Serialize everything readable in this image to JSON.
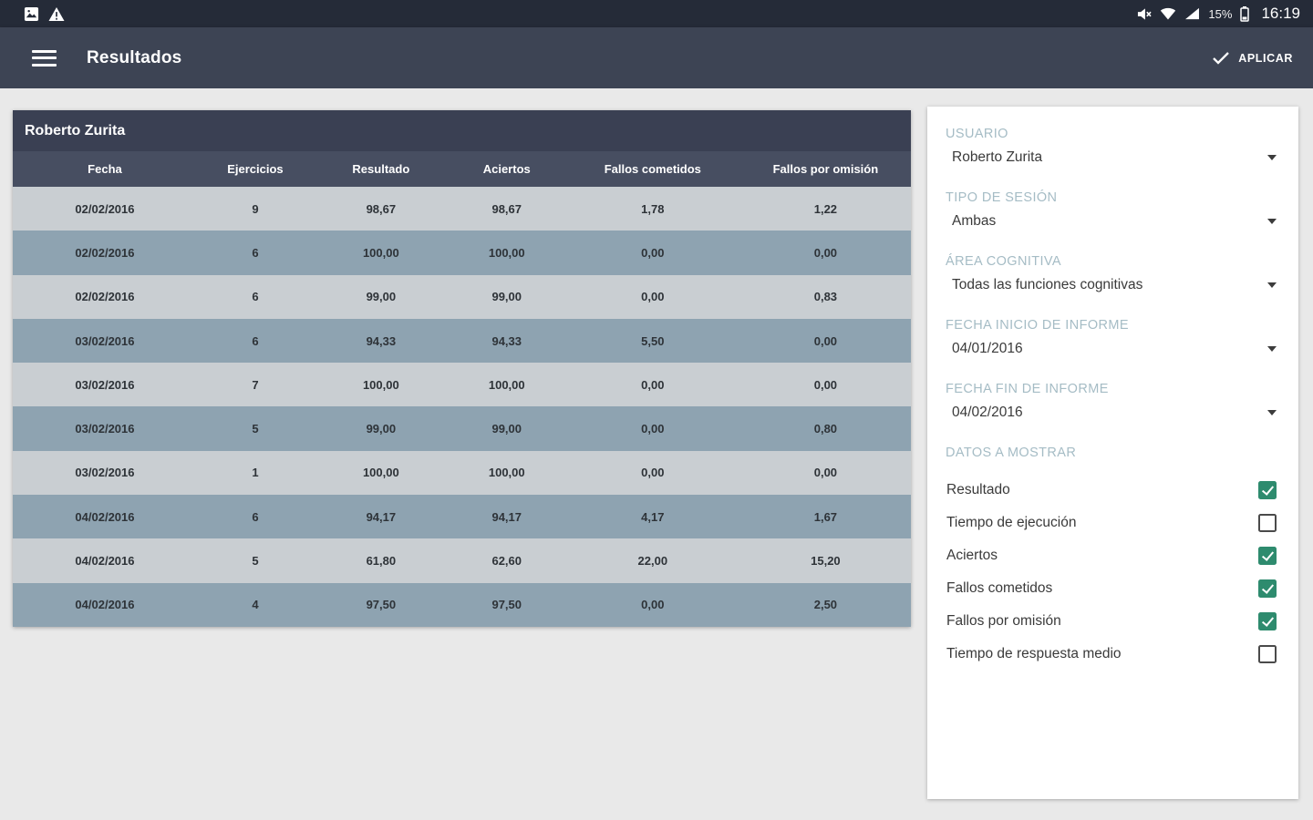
{
  "status_bar": {
    "time": "16:19",
    "battery_level": "15%",
    "icons_left": [
      "image-icon",
      "warning-icon"
    ],
    "icons_right": [
      "mute-icon",
      "wifi-icon",
      "signal-icon",
      "battery-icon"
    ]
  },
  "app_bar": {
    "title": "Resultados",
    "apply_label": "APLICAR",
    "icons": [
      "menu-icon",
      "check-icon"
    ]
  },
  "table": {
    "title": "Roberto Zurita",
    "columns": [
      "Fecha",
      "Ejercicios",
      "Resultado",
      "Aciertos",
      "Fallos cometidos",
      "Fallos por omisión"
    ],
    "rows": [
      [
        "02/02/2016",
        "9",
        "98,67",
        "98,67",
        "1,78",
        "1,22"
      ],
      [
        "02/02/2016",
        "6",
        "100,00",
        "100,00",
        "0,00",
        "0,00"
      ],
      [
        "02/02/2016",
        "6",
        "99,00",
        "99,00",
        "0,00",
        "0,83"
      ],
      [
        "03/02/2016",
        "6",
        "94,33",
        "94,33",
        "5,50",
        "0,00"
      ],
      [
        "03/02/2016",
        "7",
        "100,00",
        "100,00",
        "0,00",
        "0,00"
      ],
      [
        "03/02/2016",
        "5",
        "99,00",
        "99,00",
        "0,00",
        "0,80"
      ],
      [
        "03/02/2016",
        "1",
        "100,00",
        "100,00",
        "0,00",
        "0,00"
      ],
      [
        "04/02/2016",
        "6",
        "94,17",
        "94,17",
        "4,17",
        "1,67"
      ],
      [
        "04/02/2016",
        "5",
        "61,80",
        "62,60",
        "22,00",
        "15,20"
      ],
      [
        "04/02/2016",
        "4",
        "97,50",
        "97,50",
        "0,00",
        "2,50"
      ]
    ]
  },
  "filters": {
    "groups": [
      {
        "label": "USUARIO",
        "value": "Roberto Zurita"
      },
      {
        "label": "TIPO DE SESIÓN",
        "value": "Ambas"
      },
      {
        "label": "ÁREA COGNITIVA",
        "value": "Todas las funciones cognitivas"
      },
      {
        "label": "FECHA INICIO DE INFORME",
        "value": "04/01/2016"
      },
      {
        "label": "FECHA FIN DE INFORME",
        "value": "04/02/2016"
      }
    ],
    "datos_label": "DATOS A MOSTRAR",
    "checkboxes": [
      {
        "label": "Resultado",
        "checked": true
      },
      {
        "label": "Tiempo de ejecución",
        "checked": false
      },
      {
        "label": "Aciertos",
        "checked": true
      },
      {
        "label": "Fallos cometidos",
        "checked": true
      },
      {
        "label": "Fallos por omisión",
        "checked": true
      },
      {
        "label": "Tiempo de respuesta medio",
        "checked": false
      }
    ]
  },
  "colors": {
    "status_bar": "#252b38",
    "app_bar": "#3d4454",
    "table_title_bg": "#3a4053",
    "table_header_bg": "#474e61",
    "row_light": "#c9ced2",
    "row_dark": "#8ea3b1",
    "panel_label": "#a5bcc5",
    "checkbox_checked": "#2e8b6e",
    "background": "#e9e9e9"
  }
}
